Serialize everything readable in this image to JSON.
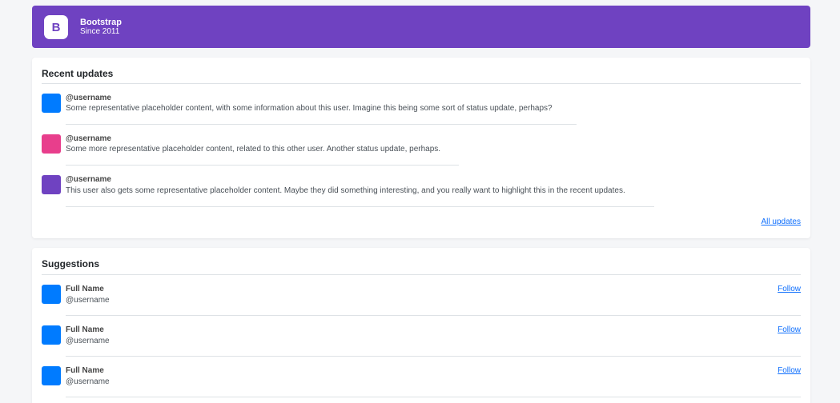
{
  "brand": {
    "name": "Bootstrap",
    "since": "Since 2011",
    "logo_letter": "B"
  },
  "updates": {
    "title": "Recent updates",
    "items": [
      {
        "username": "@username",
        "text": "Some representative placeholder content, with some information about this user. Imagine this being some sort of status update, perhaps?",
        "color": "#007bff"
      },
      {
        "username": "@username",
        "text": "Some more representative placeholder content, related to this other user. Another status update, perhaps.",
        "color": "#e83e8c"
      },
      {
        "username": "@username",
        "text": "This user also gets some representative placeholder content. Maybe they did something interesting, and you really want to highlight this in the recent updates.",
        "color": "#6f42c1"
      }
    ],
    "all_link": "All updates"
  },
  "suggestions": {
    "title": "Suggestions",
    "items": [
      {
        "name": "Full Name",
        "username": "@username",
        "action": "Follow",
        "color": "#007bff"
      },
      {
        "name": "Full Name",
        "username": "@username",
        "action": "Follow",
        "color": "#007bff"
      },
      {
        "name": "Full Name",
        "username": "@username",
        "action": "Follow",
        "color": "#007bff"
      }
    ]
  }
}
